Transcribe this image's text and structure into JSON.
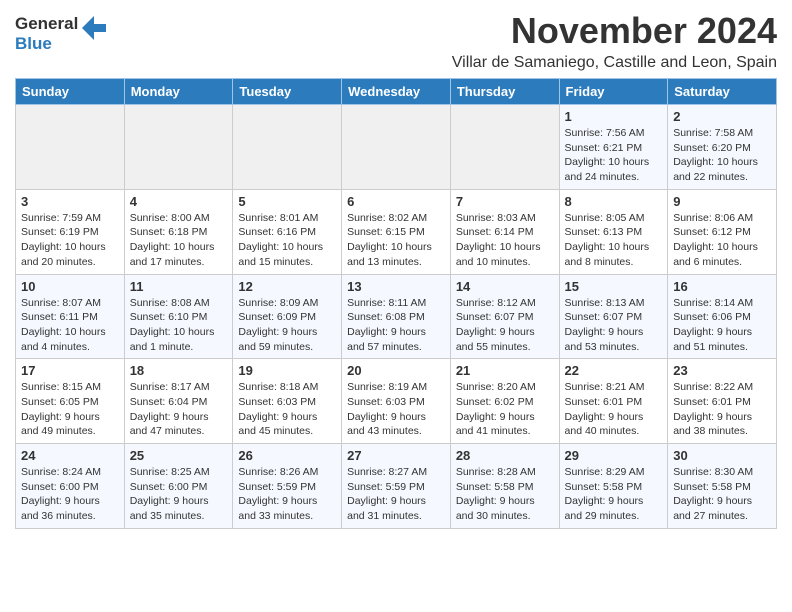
{
  "logo": {
    "general": "General",
    "blue": "Blue"
  },
  "title": "November 2024",
  "location": "Villar de Samaniego, Castille and Leon, Spain",
  "days_of_week": [
    "Sunday",
    "Monday",
    "Tuesday",
    "Wednesday",
    "Thursday",
    "Friday",
    "Saturday"
  ],
  "weeks": [
    [
      {
        "day": "",
        "info": ""
      },
      {
        "day": "",
        "info": ""
      },
      {
        "day": "",
        "info": ""
      },
      {
        "day": "",
        "info": ""
      },
      {
        "day": "",
        "info": ""
      },
      {
        "day": "1",
        "info": "Sunrise: 7:56 AM\nSunset: 6:21 PM\nDaylight: 10 hours and 24 minutes."
      },
      {
        "day": "2",
        "info": "Sunrise: 7:58 AM\nSunset: 6:20 PM\nDaylight: 10 hours and 22 minutes."
      }
    ],
    [
      {
        "day": "3",
        "info": "Sunrise: 7:59 AM\nSunset: 6:19 PM\nDaylight: 10 hours and 20 minutes."
      },
      {
        "day": "4",
        "info": "Sunrise: 8:00 AM\nSunset: 6:18 PM\nDaylight: 10 hours and 17 minutes."
      },
      {
        "day": "5",
        "info": "Sunrise: 8:01 AM\nSunset: 6:16 PM\nDaylight: 10 hours and 15 minutes."
      },
      {
        "day": "6",
        "info": "Sunrise: 8:02 AM\nSunset: 6:15 PM\nDaylight: 10 hours and 13 minutes."
      },
      {
        "day": "7",
        "info": "Sunrise: 8:03 AM\nSunset: 6:14 PM\nDaylight: 10 hours and 10 minutes."
      },
      {
        "day": "8",
        "info": "Sunrise: 8:05 AM\nSunset: 6:13 PM\nDaylight: 10 hours and 8 minutes."
      },
      {
        "day": "9",
        "info": "Sunrise: 8:06 AM\nSunset: 6:12 PM\nDaylight: 10 hours and 6 minutes."
      }
    ],
    [
      {
        "day": "10",
        "info": "Sunrise: 8:07 AM\nSunset: 6:11 PM\nDaylight: 10 hours and 4 minutes."
      },
      {
        "day": "11",
        "info": "Sunrise: 8:08 AM\nSunset: 6:10 PM\nDaylight: 10 hours and 1 minute."
      },
      {
        "day": "12",
        "info": "Sunrise: 8:09 AM\nSunset: 6:09 PM\nDaylight: 9 hours and 59 minutes."
      },
      {
        "day": "13",
        "info": "Sunrise: 8:11 AM\nSunset: 6:08 PM\nDaylight: 9 hours and 57 minutes."
      },
      {
        "day": "14",
        "info": "Sunrise: 8:12 AM\nSunset: 6:07 PM\nDaylight: 9 hours and 55 minutes."
      },
      {
        "day": "15",
        "info": "Sunrise: 8:13 AM\nSunset: 6:07 PM\nDaylight: 9 hours and 53 minutes."
      },
      {
        "day": "16",
        "info": "Sunrise: 8:14 AM\nSunset: 6:06 PM\nDaylight: 9 hours and 51 minutes."
      }
    ],
    [
      {
        "day": "17",
        "info": "Sunrise: 8:15 AM\nSunset: 6:05 PM\nDaylight: 9 hours and 49 minutes."
      },
      {
        "day": "18",
        "info": "Sunrise: 8:17 AM\nSunset: 6:04 PM\nDaylight: 9 hours and 47 minutes."
      },
      {
        "day": "19",
        "info": "Sunrise: 8:18 AM\nSunset: 6:03 PM\nDaylight: 9 hours and 45 minutes."
      },
      {
        "day": "20",
        "info": "Sunrise: 8:19 AM\nSunset: 6:03 PM\nDaylight: 9 hours and 43 minutes."
      },
      {
        "day": "21",
        "info": "Sunrise: 8:20 AM\nSunset: 6:02 PM\nDaylight: 9 hours and 41 minutes."
      },
      {
        "day": "22",
        "info": "Sunrise: 8:21 AM\nSunset: 6:01 PM\nDaylight: 9 hours and 40 minutes."
      },
      {
        "day": "23",
        "info": "Sunrise: 8:22 AM\nSunset: 6:01 PM\nDaylight: 9 hours and 38 minutes."
      }
    ],
    [
      {
        "day": "24",
        "info": "Sunrise: 8:24 AM\nSunset: 6:00 PM\nDaylight: 9 hours and 36 minutes."
      },
      {
        "day": "25",
        "info": "Sunrise: 8:25 AM\nSunset: 6:00 PM\nDaylight: 9 hours and 35 minutes."
      },
      {
        "day": "26",
        "info": "Sunrise: 8:26 AM\nSunset: 5:59 PM\nDaylight: 9 hours and 33 minutes."
      },
      {
        "day": "27",
        "info": "Sunrise: 8:27 AM\nSunset: 5:59 PM\nDaylight: 9 hours and 31 minutes."
      },
      {
        "day": "28",
        "info": "Sunrise: 8:28 AM\nSunset: 5:58 PM\nDaylight: 9 hours and 30 minutes."
      },
      {
        "day": "29",
        "info": "Sunrise: 8:29 AM\nSunset: 5:58 PM\nDaylight: 9 hours and 29 minutes."
      },
      {
        "day": "30",
        "info": "Sunrise: 8:30 AM\nSunset: 5:58 PM\nDaylight: 9 hours and 27 minutes."
      }
    ]
  ]
}
